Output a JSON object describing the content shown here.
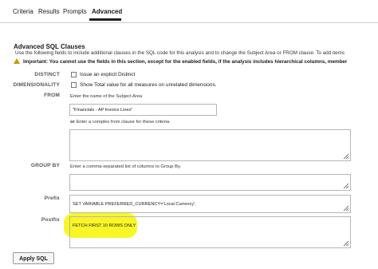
{
  "tabs": [
    {
      "label": "Criteria",
      "active": false
    },
    {
      "label": "Results",
      "active": false
    },
    {
      "label": "Prompts",
      "active": false
    },
    {
      "label": "Advanced",
      "active": true
    }
  ],
  "section": {
    "title": "Advanced SQL Clauses",
    "description": "Use the following fields to include additional clauses in the SQL code for this analysis and to change the Subject Area or FROM clause. To add items",
    "warning": "Important: You cannot use the fields in this section, except for the enabled fields, if the analysis includes hierarchical columns, member"
  },
  "distinct": {
    "label": "DISTINCT",
    "checkbox_label": "Issue an explicit Distinct",
    "checked": false
  },
  "dimensionality": {
    "label": "DIMENSIONALITY",
    "checkbox_label": "Show Total value for all measures on unrelated dimensions.",
    "checked": false
  },
  "from": {
    "label": "FROM",
    "hint": "Enter the name of the Subject Area",
    "subject_area_value": "\"Financials - AP Invoice Lines\"",
    "or_prefix": "or",
    "or_hint": "Enter a complex from clause for these criteria.",
    "complex_value": ""
  },
  "group_by": {
    "label": "GROUP BY",
    "hint": "Enter a comma-separated list of columns to Group By.",
    "value": ""
  },
  "prefix": {
    "label": "Prefix",
    "value": "SET VARIABLE PREFERRED_CURRENCY='Local Currency';"
  },
  "postfix": {
    "label": "Postfix",
    "value": "FETCH FIRST 10 ROWS ONLY"
  },
  "apply_button": {
    "label": "Apply SQL"
  },
  "colors": {
    "highlight": "#f7f500",
    "warning_icon": "#c79a00"
  }
}
